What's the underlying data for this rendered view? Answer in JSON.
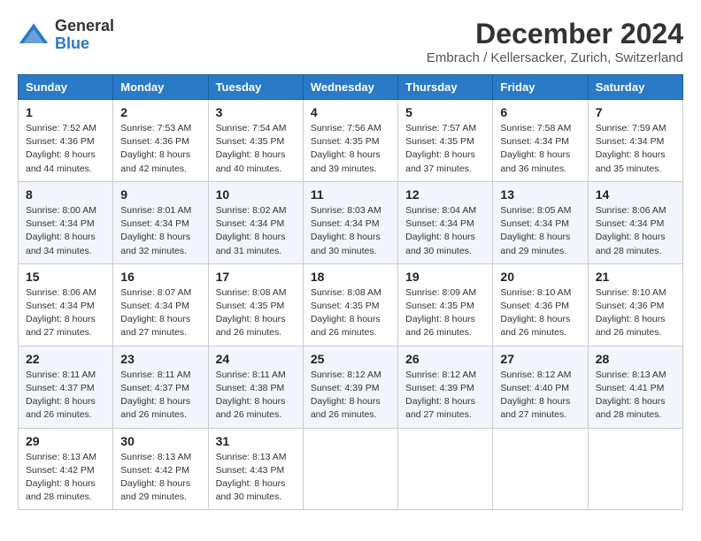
{
  "header": {
    "logo_general": "General",
    "logo_blue": "Blue",
    "month_title": "December 2024",
    "location": "Embrach / Kellersacker, Zurich, Switzerland"
  },
  "calendar": {
    "days_of_week": [
      "Sunday",
      "Monday",
      "Tuesday",
      "Wednesday",
      "Thursday",
      "Friday",
      "Saturday"
    ],
    "weeks": [
      [
        {
          "day": "1",
          "sunrise": "Sunrise: 7:52 AM",
          "sunset": "Sunset: 4:36 PM",
          "daylight": "Daylight: 8 hours and 44 minutes."
        },
        {
          "day": "2",
          "sunrise": "Sunrise: 7:53 AM",
          "sunset": "Sunset: 4:36 PM",
          "daylight": "Daylight: 8 hours and 42 minutes."
        },
        {
          "day": "3",
          "sunrise": "Sunrise: 7:54 AM",
          "sunset": "Sunset: 4:35 PM",
          "daylight": "Daylight: 8 hours and 40 minutes."
        },
        {
          "day": "4",
          "sunrise": "Sunrise: 7:56 AM",
          "sunset": "Sunset: 4:35 PM",
          "daylight": "Daylight: 8 hours and 39 minutes."
        },
        {
          "day": "5",
          "sunrise": "Sunrise: 7:57 AM",
          "sunset": "Sunset: 4:35 PM",
          "daylight": "Daylight: 8 hours and 37 minutes."
        },
        {
          "day": "6",
          "sunrise": "Sunrise: 7:58 AM",
          "sunset": "Sunset: 4:34 PM",
          "daylight": "Daylight: 8 hours and 36 minutes."
        },
        {
          "day": "7",
          "sunrise": "Sunrise: 7:59 AM",
          "sunset": "Sunset: 4:34 PM",
          "daylight": "Daylight: 8 hours and 35 minutes."
        }
      ],
      [
        {
          "day": "8",
          "sunrise": "Sunrise: 8:00 AM",
          "sunset": "Sunset: 4:34 PM",
          "daylight": "Daylight: 8 hours and 34 minutes."
        },
        {
          "day": "9",
          "sunrise": "Sunrise: 8:01 AM",
          "sunset": "Sunset: 4:34 PM",
          "daylight": "Daylight: 8 hours and 32 minutes."
        },
        {
          "day": "10",
          "sunrise": "Sunrise: 8:02 AM",
          "sunset": "Sunset: 4:34 PM",
          "daylight": "Daylight: 8 hours and 31 minutes."
        },
        {
          "day": "11",
          "sunrise": "Sunrise: 8:03 AM",
          "sunset": "Sunset: 4:34 PM",
          "daylight": "Daylight: 8 hours and 30 minutes."
        },
        {
          "day": "12",
          "sunrise": "Sunrise: 8:04 AM",
          "sunset": "Sunset: 4:34 PM",
          "daylight": "Daylight: 8 hours and 30 minutes."
        },
        {
          "day": "13",
          "sunrise": "Sunrise: 8:05 AM",
          "sunset": "Sunset: 4:34 PM",
          "daylight": "Daylight: 8 hours and 29 minutes."
        },
        {
          "day": "14",
          "sunrise": "Sunrise: 8:06 AM",
          "sunset": "Sunset: 4:34 PM",
          "daylight": "Daylight: 8 hours and 28 minutes."
        }
      ],
      [
        {
          "day": "15",
          "sunrise": "Sunrise: 8:06 AM",
          "sunset": "Sunset: 4:34 PM",
          "daylight": "Daylight: 8 hours and 27 minutes."
        },
        {
          "day": "16",
          "sunrise": "Sunrise: 8:07 AM",
          "sunset": "Sunset: 4:34 PM",
          "daylight": "Daylight: 8 hours and 27 minutes."
        },
        {
          "day": "17",
          "sunrise": "Sunrise: 8:08 AM",
          "sunset": "Sunset: 4:35 PM",
          "daylight": "Daylight: 8 hours and 26 minutes."
        },
        {
          "day": "18",
          "sunrise": "Sunrise: 8:08 AM",
          "sunset": "Sunset: 4:35 PM",
          "daylight": "Daylight: 8 hours and 26 minutes."
        },
        {
          "day": "19",
          "sunrise": "Sunrise: 8:09 AM",
          "sunset": "Sunset: 4:35 PM",
          "daylight": "Daylight: 8 hours and 26 minutes."
        },
        {
          "day": "20",
          "sunrise": "Sunrise: 8:10 AM",
          "sunset": "Sunset: 4:36 PM",
          "daylight": "Daylight: 8 hours and 26 minutes."
        },
        {
          "day": "21",
          "sunrise": "Sunrise: 8:10 AM",
          "sunset": "Sunset: 4:36 PM",
          "daylight": "Daylight: 8 hours and 26 minutes."
        }
      ],
      [
        {
          "day": "22",
          "sunrise": "Sunrise: 8:11 AM",
          "sunset": "Sunset: 4:37 PM",
          "daylight": "Daylight: 8 hours and 26 minutes."
        },
        {
          "day": "23",
          "sunrise": "Sunrise: 8:11 AM",
          "sunset": "Sunset: 4:37 PM",
          "daylight": "Daylight: 8 hours and 26 minutes."
        },
        {
          "day": "24",
          "sunrise": "Sunrise: 8:11 AM",
          "sunset": "Sunset: 4:38 PM",
          "daylight": "Daylight: 8 hours and 26 minutes."
        },
        {
          "day": "25",
          "sunrise": "Sunrise: 8:12 AM",
          "sunset": "Sunset: 4:39 PM",
          "daylight": "Daylight: 8 hours and 26 minutes."
        },
        {
          "day": "26",
          "sunrise": "Sunrise: 8:12 AM",
          "sunset": "Sunset: 4:39 PM",
          "daylight": "Daylight: 8 hours and 27 minutes."
        },
        {
          "day": "27",
          "sunrise": "Sunrise: 8:12 AM",
          "sunset": "Sunset: 4:40 PM",
          "daylight": "Daylight: 8 hours and 27 minutes."
        },
        {
          "day": "28",
          "sunrise": "Sunrise: 8:13 AM",
          "sunset": "Sunset: 4:41 PM",
          "daylight": "Daylight: 8 hours and 28 minutes."
        }
      ],
      [
        {
          "day": "29",
          "sunrise": "Sunrise: 8:13 AM",
          "sunset": "Sunset: 4:42 PM",
          "daylight": "Daylight: 8 hours and 28 minutes."
        },
        {
          "day": "30",
          "sunrise": "Sunrise: 8:13 AM",
          "sunset": "Sunset: 4:42 PM",
          "daylight": "Daylight: 8 hours and 29 minutes."
        },
        {
          "day": "31",
          "sunrise": "Sunrise: 8:13 AM",
          "sunset": "Sunset: 4:43 PM",
          "daylight": "Daylight: 8 hours and 30 minutes."
        },
        null,
        null,
        null,
        null
      ]
    ]
  }
}
